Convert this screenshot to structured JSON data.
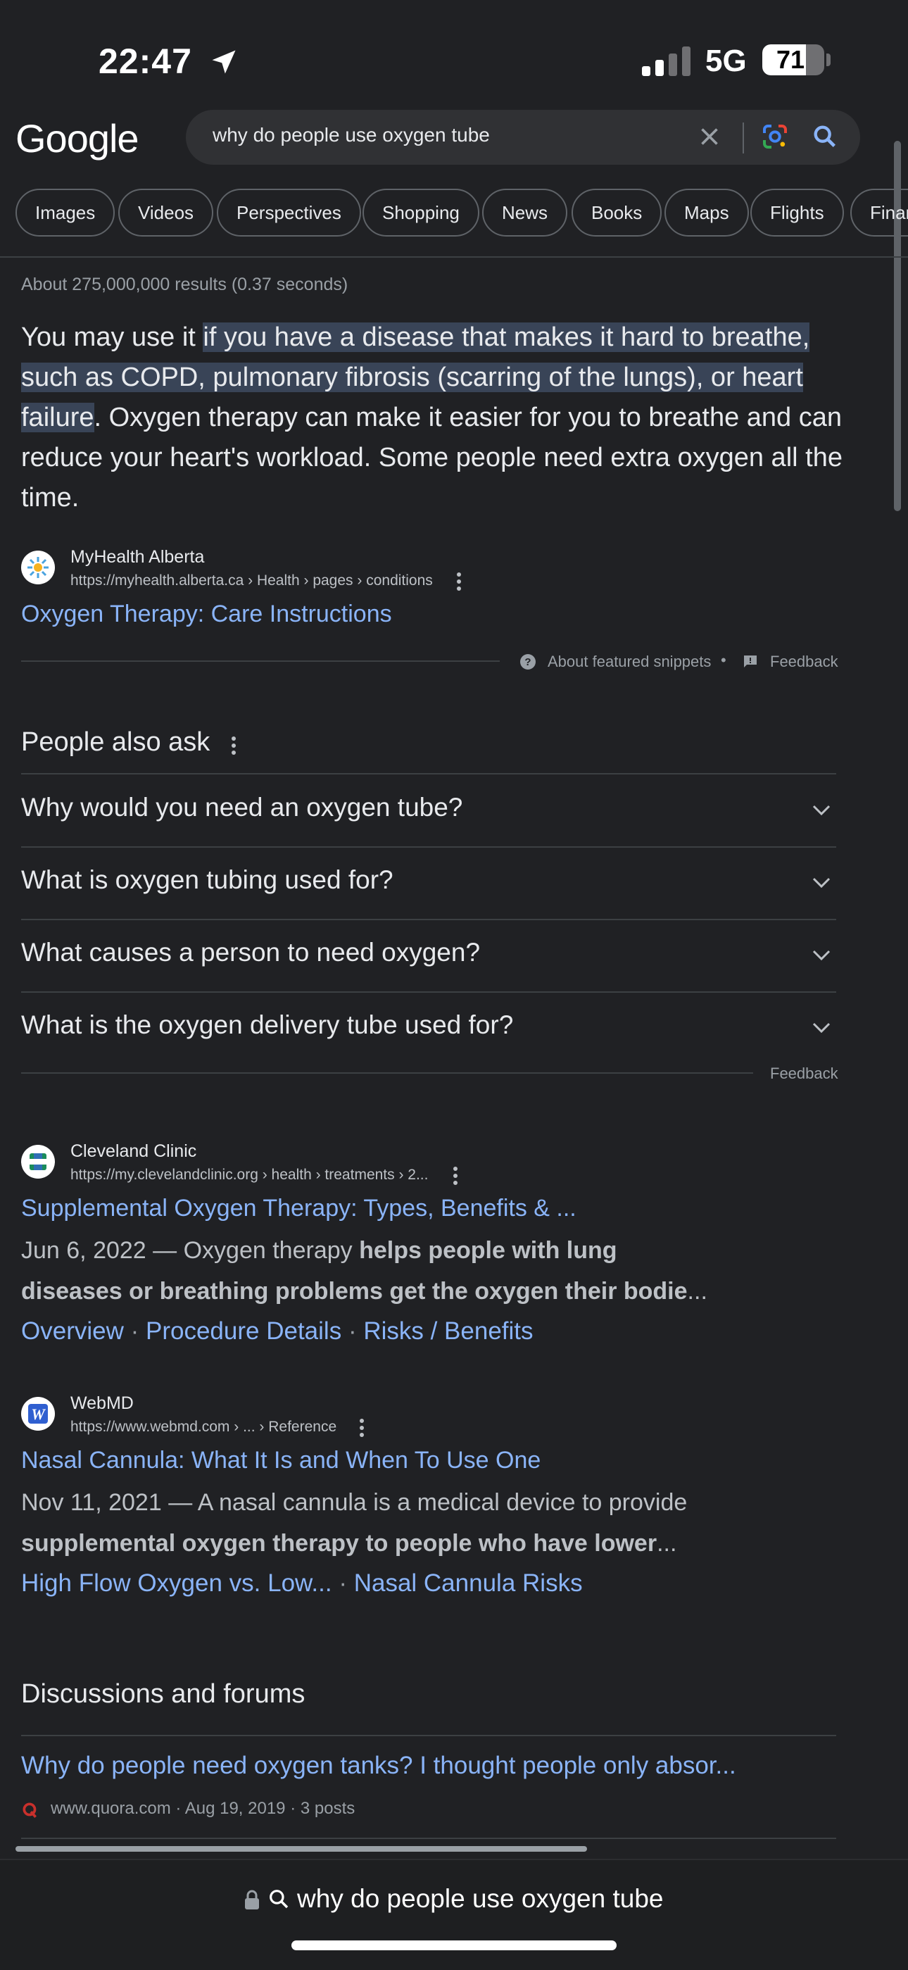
{
  "status_bar": {
    "time": "22:47",
    "network": "5G",
    "battery": "71",
    "battery_level": 0.71
  },
  "header": {
    "logo": "Google",
    "query": "why do people use oxygen tube",
    "chips": [
      "Images",
      "Videos",
      "Perspectives",
      "Shopping",
      "News",
      "Books",
      "Maps",
      "Flights",
      "Finan"
    ]
  },
  "stats": "About 275,000,000 results (0.37 seconds)",
  "featured_snippet": {
    "text_before": "You may use it ",
    "text_highlight": "if you have a disease that makes it hard to breathe, such as COPD, pulmonary fibrosis (scarring of the lungs), or heart failure",
    "text_after": ". Oxygen therapy can make it easier for you to breathe and can reduce your heart's workload. Some people need extra oxygen all the time.",
    "source_name": "MyHealth Alberta",
    "source_url": "https://myhealth.alberta.ca › Health › pages › conditions",
    "title": "Oxygen Therapy: Care Instructions",
    "about": "About featured snippets",
    "separator": "•",
    "feedback": "Feedback"
  },
  "people_also_ask": {
    "title": "People also ask",
    "questions": [
      "Why would you need an oxygen tube?",
      "What is oxygen tubing used for?",
      "What causes a person to need oxygen?",
      "What is the oxygen delivery tube used for?"
    ],
    "feedback": "Feedback"
  },
  "results": [
    {
      "source_name": "Cleveland Clinic",
      "url": "https://my.clevelandclinic.org › health › treatments › 2...",
      "title": "Supplemental Oxygen Therapy: Types, Benefits & ...",
      "date": "Jun 6, 2022",
      "snippet_plain": "Oxygen therapy ",
      "snippet_bold_1": "helps people with lung",
      "snippet_bold_2": "diseases or breathing problems get the oxygen their bodie",
      "ellipsis": "...",
      "sitelinks": [
        "Overview",
        "Procedure Details",
        "Risks / Benefits"
      ]
    },
    {
      "source_name": "WebMD",
      "url": "https://www.webmd.com › ... › Reference",
      "title": "Nasal Cannula: What It Is and When To Use One",
      "date": "Nov 11, 2021",
      "snippet_plain": "A nasal cannula is a medical device to provide",
      "snippet_bold_2": "supplemental oxygen therapy to people who have lower",
      "ellipsis": "...",
      "sitelinks": [
        "High Flow Oxygen vs. Low...",
        "Nasal Cannula Risks"
      ]
    }
  ],
  "discussions": {
    "title": "Discussions and forums",
    "item_title": "Why do people need oxygen tanks? I thought people only absor...",
    "item_meta": "www.quora.com · Aug 19, 2019 · 3 posts"
  },
  "dash": "—",
  "sep_dot": "·",
  "address_bar": {
    "text": "why do people use oxygen tube"
  },
  "colors": {
    "background": "#202124",
    "link": "#8ab4f8",
    "highlight": "#394457"
  }
}
